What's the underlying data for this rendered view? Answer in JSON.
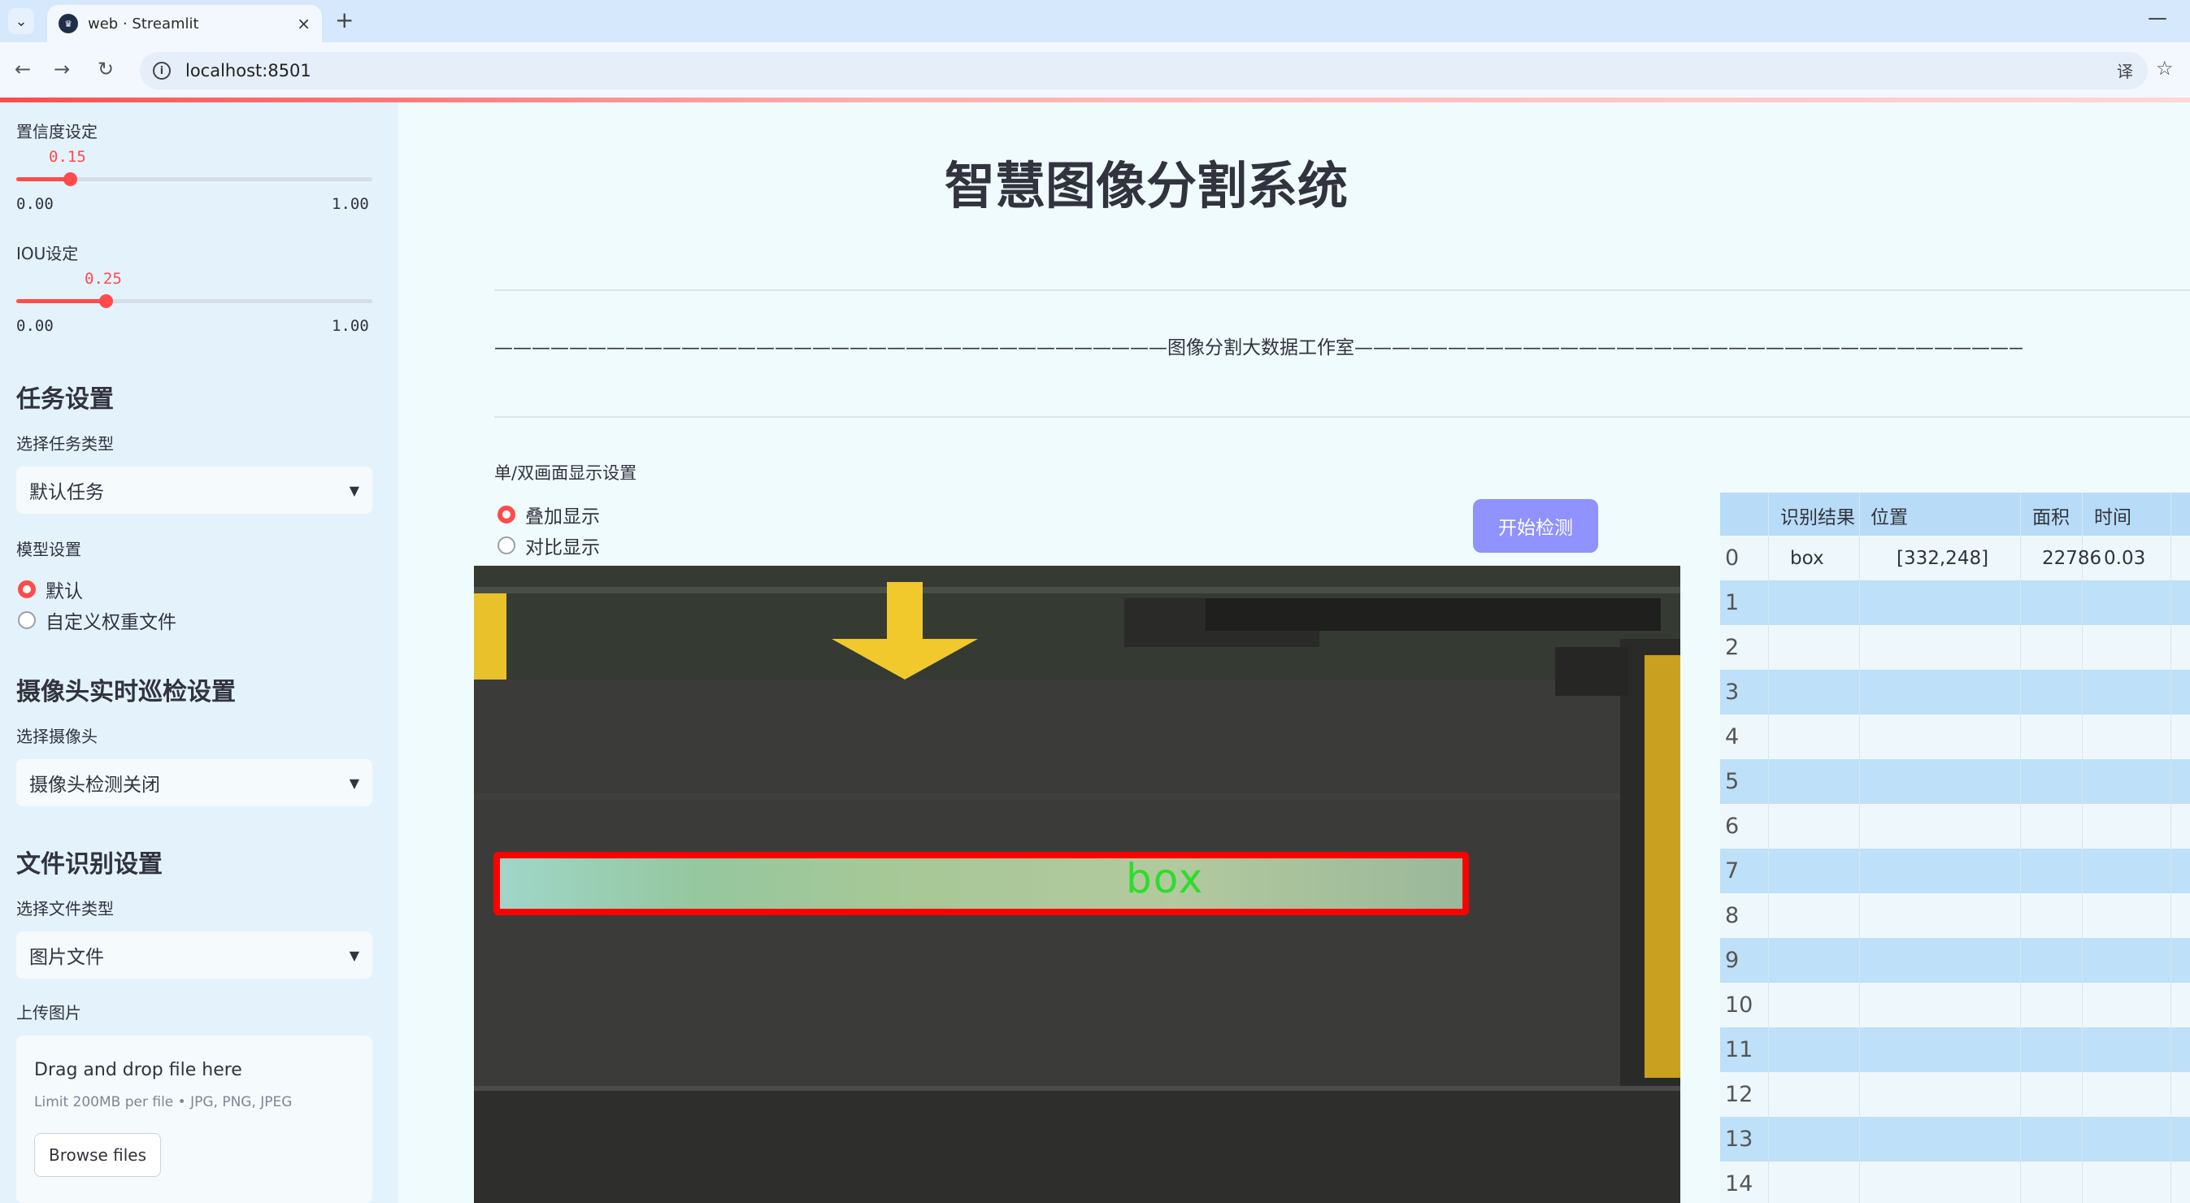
{
  "browser": {
    "tab_title": "web · Streamlit",
    "url": "localhost:8501",
    "back_icon": "←",
    "forward_icon": "→",
    "reload_icon": "↻",
    "translate_icon": "译",
    "star_icon": "☆",
    "new_tab": "+",
    "close_tab": "×",
    "minimize": "—"
  },
  "sidebar": {
    "confidence": {
      "label": "置信度设定",
      "value": "0.15",
      "min": "0.00",
      "max": "1.00",
      "fraction": 0.15
    },
    "iou": {
      "label": "IOU设定",
      "value": "0.25",
      "min": "0.00",
      "max": "1.00",
      "fraction": 0.25
    },
    "task_header": "任务设置",
    "task_type_label": "选择任务类型",
    "task_type_value": "默认任务",
    "model_label": "模型设置",
    "model_options": [
      "默认",
      "自定义权重文件"
    ],
    "model_selected": 0,
    "camera_header": "摄像头实时巡检设置",
    "camera_label": "选择摄像头",
    "camera_value": "摄像头检测关闭",
    "file_header": "文件识别设置",
    "file_type_label": "选择文件类型",
    "file_type_value": "图片文件",
    "upload_label": "上传图片",
    "upload_title": "Drag and drop file here",
    "upload_limit": "Limit 200MB per file • JPG, PNG, JPEG",
    "browse_label": "Browse files"
  },
  "main": {
    "title": "智慧图像分割系统",
    "subtitle": "————————————————————————————————————图像分割大数据工作室—————————————————————————————————————————",
    "display_label": "单/双画面显示设置",
    "display_options": [
      "叠加显示",
      "对比显示"
    ],
    "display_selected": 0,
    "start_button": "开始检测",
    "detection_label": "box"
  },
  "table": {
    "headers": [
      "",
      "识别结果",
      "位置",
      "面积",
      "时间"
    ],
    "rows": [
      [
        "0",
        "box",
        "[332,248]",
        "22786",
        "0.03"
      ],
      [
        "1",
        "",
        "",
        "",
        ""
      ],
      [
        "2",
        "",
        "",
        "",
        ""
      ],
      [
        "3",
        "",
        "",
        "",
        ""
      ],
      [
        "4",
        "",
        "",
        "",
        ""
      ],
      [
        "5",
        "",
        "",
        "",
        ""
      ],
      [
        "6",
        "",
        "",
        "",
        ""
      ],
      [
        "7",
        "",
        "",
        "",
        ""
      ],
      [
        "8",
        "",
        "",
        "",
        ""
      ],
      [
        "9",
        "",
        "",
        "",
        ""
      ],
      [
        "10",
        "",
        "",
        "",
        ""
      ],
      [
        "11",
        "",
        "",
        "",
        ""
      ],
      [
        "12",
        "",
        "",
        "",
        ""
      ],
      [
        "13",
        "",
        "",
        "",
        ""
      ],
      [
        "14",
        "",
        "",
        "",
        ""
      ]
    ]
  },
  "colors": {
    "accent": "#ff4b4b",
    "button": "#8f92ff",
    "sidebar_bg": "#e4f2fb",
    "main_bg": "#f0fbfd",
    "box_border": "#ff0000",
    "box_label": "#2edc2e"
  }
}
